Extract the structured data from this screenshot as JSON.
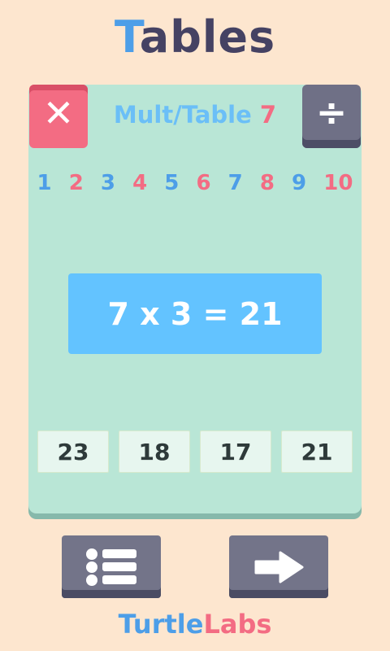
{
  "app": {
    "title_first_letter": "T",
    "title_rest": "ables"
  },
  "header": {
    "label": "Mult/Table",
    "table_number": "7",
    "multiply_glyph": "✕",
    "divide_glyph": "÷"
  },
  "number_selector": [
    "1",
    "2",
    "3",
    "4",
    "5",
    "6",
    "7",
    "8",
    "9",
    "10"
  ],
  "equation": "7 x 3 = 21",
  "answers": [
    "23",
    "18",
    "17",
    "21"
  ],
  "bottom": {
    "list_icon": "list-icon",
    "next_icon": "arrow-right-icon"
  },
  "brand": {
    "part1": "Turtle",
    "part2": "Labs"
  },
  "colors": {
    "background": "#fde6cf",
    "card": "#b9e6d6",
    "blue": "#4d9ee8",
    "pink": "#f36c83",
    "equation_bg": "#63c3ff",
    "button_gray": "#737489"
  }
}
